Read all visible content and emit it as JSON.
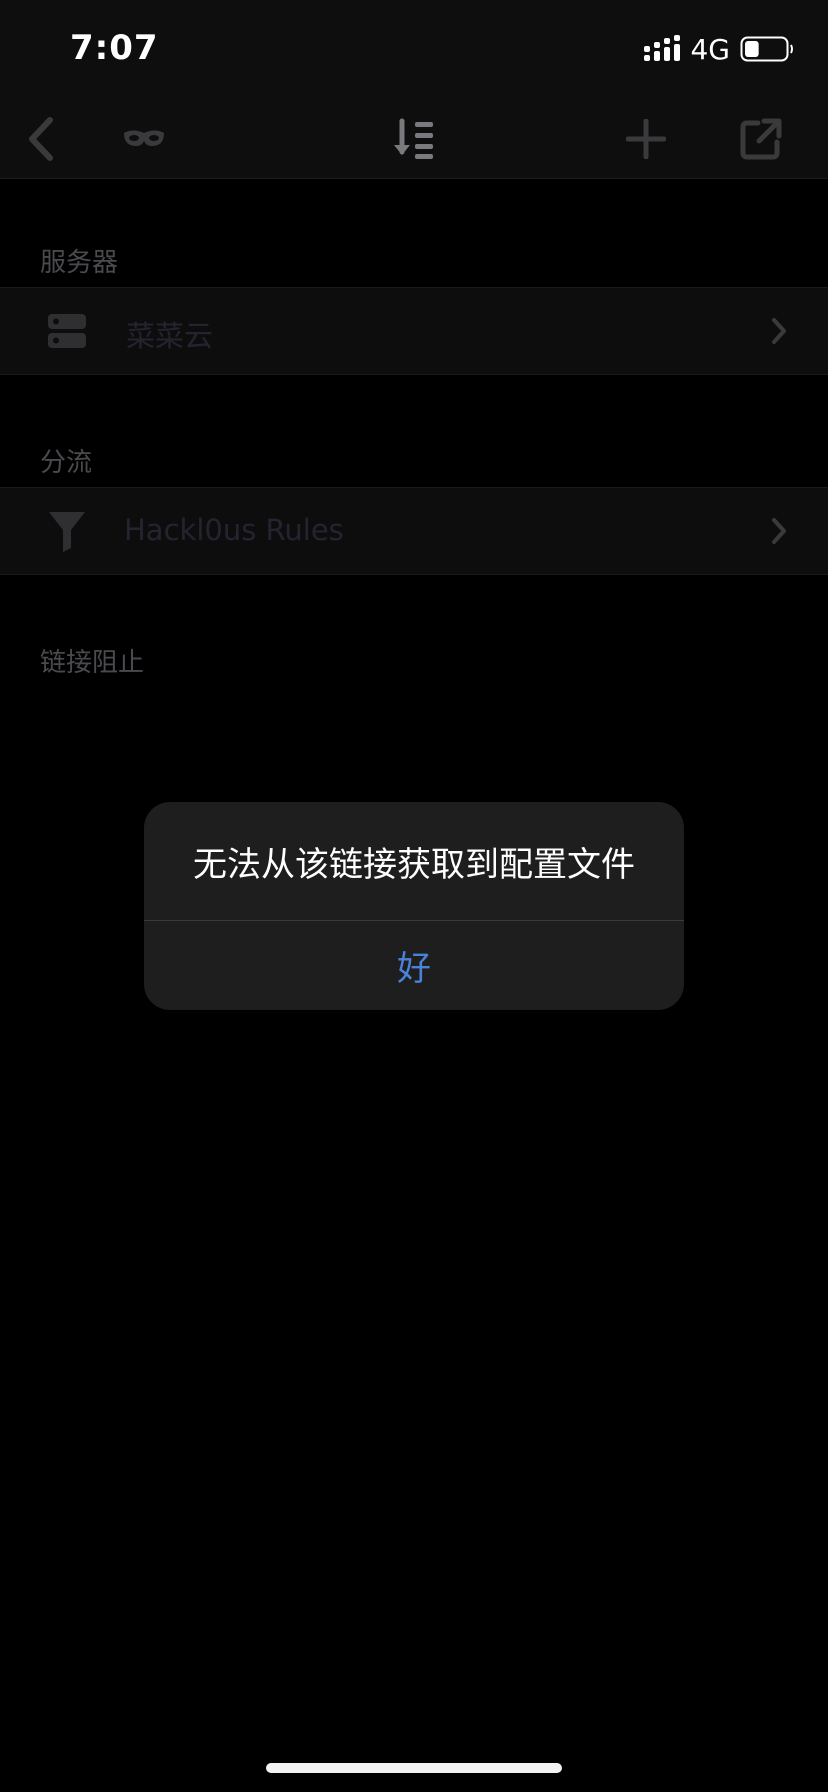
{
  "status_bar": {
    "time": "7:07",
    "network": "4G",
    "battery_level": 0.35
  },
  "nav_bar": {
    "icons": [
      "chevron-left-icon",
      "mask-icon",
      "sort-icon",
      "plus-icon",
      "export-icon"
    ]
  },
  "sections": {
    "server": {
      "header": "服务器",
      "row_label": "菜菜云",
      "row_icon": "server-icon"
    },
    "routing": {
      "header": "分流",
      "row_label": "Hackl0us Rules",
      "row_icon": "filter-icon"
    },
    "blocking": {
      "header": "链接阻止"
    }
  },
  "alert": {
    "message": "无法从该链接获取到配置文件",
    "button_label": "好"
  },
  "colors": {
    "background": "#000000",
    "alert_background": "#1e1e1e",
    "accent": "#4a82d8"
  }
}
